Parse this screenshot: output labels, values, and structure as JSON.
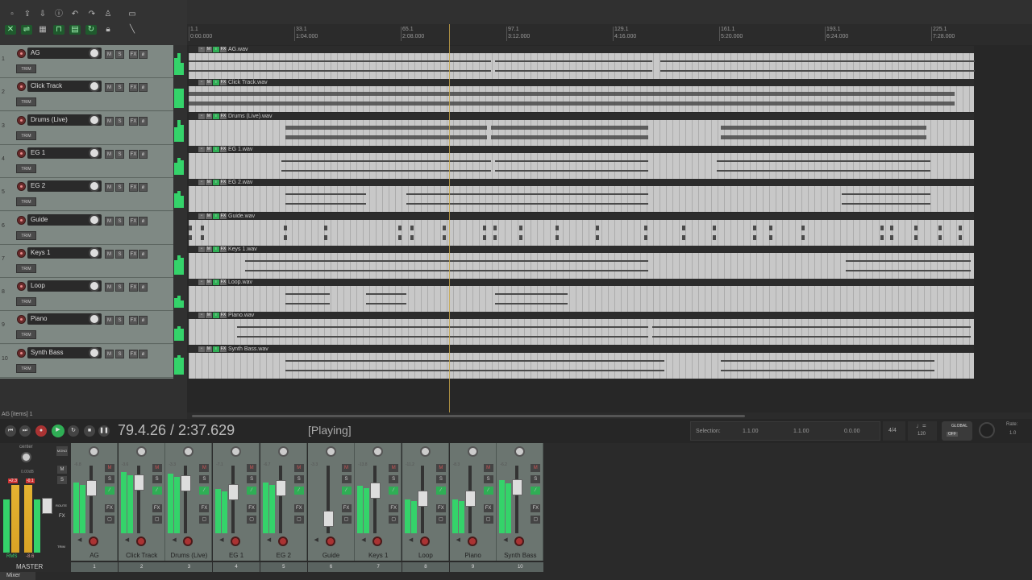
{
  "toolbar": {
    "icons": [
      "new-project-icon",
      "open-project-icon",
      "save-project-icon",
      "project-settings-icon",
      "undo-icon",
      "redo-icon",
      "metronome-icon",
      "grid-toggle-icon",
      "ripple-edit-icon",
      "item-grouping-icon",
      "snap-icon",
      "loop-icon",
      "lock-icon"
    ]
  },
  "ruler": {
    "bars": [
      {
        "bar": "1.1",
        "time": "0:00.000"
      },
      {
        "bar": "33.1",
        "time": "1:04.000"
      },
      {
        "bar": "65.1",
        "time": "2:08.000"
      },
      {
        "bar": "97.1",
        "time": "3:12.000"
      },
      {
        "bar": "129.1",
        "time": "4:16.000"
      },
      {
        "bar": "161.1",
        "time": "5:20.000"
      },
      {
        "bar": "193.1",
        "time": "6:24.000"
      },
      {
        "bar": "225.1",
        "time": "7:28.000"
      }
    ]
  },
  "tracks": [
    {
      "num": "1",
      "name": "AG",
      "file": "AG.wav",
      "meter": [
        0.7,
        0.9,
        0.5
      ]
    },
    {
      "num": "2",
      "name": "Click Track",
      "file": "Click Track.wav",
      "meter": [
        0.8,
        0.8,
        0.8
      ]
    },
    {
      "num": "3",
      "name": "Drums (Live)",
      "file": "Drums (Live).wav",
      "meter": [
        0.6,
        0.9,
        0.7
      ]
    },
    {
      "num": "4",
      "name": "EG 1",
      "file": "EG 1.wav",
      "meter": [
        0.5,
        0.7,
        0.6
      ]
    },
    {
      "num": "5",
      "name": "EG 2",
      "file": "EG 2.wav",
      "meter": [
        0.6,
        0.7,
        0.5
      ]
    },
    {
      "num": "6",
      "name": "Guide",
      "file": "Guide.wav",
      "meter": [
        0,
        0,
        0
      ]
    },
    {
      "num": "7",
      "name": "Keys 1",
      "file": "Keys 1.wav",
      "meter": [
        0.6,
        0.8,
        0.7
      ]
    },
    {
      "num": "8",
      "name": "Loop",
      "file": "Loop.wav",
      "meter": [
        0.4,
        0.5,
        0.3
      ]
    },
    {
      "num": "9",
      "name": "Piano",
      "file": "Piano.wav",
      "meter": [
        0.5,
        0.6,
        0.5
      ]
    },
    {
      "num": "10",
      "name": "Synth Bass",
      "file": "Synth Bass.wav",
      "meter": [
        0.7,
        0.8,
        0.7
      ]
    }
  ],
  "track_buttons": {
    "mute": "M",
    "solo": "S",
    "fx": "FX",
    "phase": "ø",
    "trim": "TRIM",
    "item_mute": "M",
    "item_fx": "FX"
  },
  "status_text": "AG [items] 1",
  "transport": {
    "position": "79.4.26 / 2:37.629",
    "state": "[Playing]"
  },
  "selection": {
    "label": "Selection:",
    "start": "1.1.00",
    "end": "1.1.00",
    "length": "0.0.00"
  },
  "tempo": {
    "time_sig": "4/4",
    "bpm": "120"
  },
  "global": {
    "label": "GLOBAL",
    "state": "OFF"
  },
  "rate": {
    "label": "Rate:",
    "value": "1.0"
  },
  "master": {
    "pan_label": "center",
    "vol": "0.00dB",
    "peak_l": "+2.3",
    "peak_r": "-0.1",
    "name": "MASTER",
    "rms": "RMS",
    "rms_val": "-8.6",
    "mono": "MONO",
    "route": "ROUTE",
    "trim": "TRIM",
    "fx": "FX",
    "mute": "M",
    "solo": "S"
  },
  "mixer": [
    {
      "name": "AG",
      "num": "1",
      "db": "-6.8",
      "level": 0.75
    },
    {
      "name": "Click Track",
      "num": "2",
      "db": "-3.6",
      "level": 0.9
    },
    {
      "name": "Drums (Live)",
      "num": "3",
      "db": "-3.3",
      "level": 0.88
    },
    {
      "name": "EG 1",
      "num": "4",
      "db": "-7.1",
      "level": 0.65
    },
    {
      "name": "EG 2",
      "num": "5",
      "db": "-6.7",
      "level": 0.75
    },
    {
      "name": "Guide",
      "num": "6",
      "db": "-3.3",
      "level": 0.0
    },
    {
      "name": "Keys 1",
      "num": "7",
      "db": "-13.8",
      "level": 0.7
    },
    {
      "name": "Loop",
      "num": "8",
      "db": "-11.2",
      "level": 0.5
    },
    {
      "name": "Piano",
      "num": "9",
      "db": "-8.3",
      "level": 0.5
    },
    {
      "name": "Synth Bass",
      "num": "10",
      "db": "-6.2",
      "level": 0.78
    }
  ],
  "mixer_tab": "Mixer",
  "colors": {
    "meter_green": "#34d36a",
    "record_red": "#b03a3a",
    "cursor": "#c9a64a"
  }
}
